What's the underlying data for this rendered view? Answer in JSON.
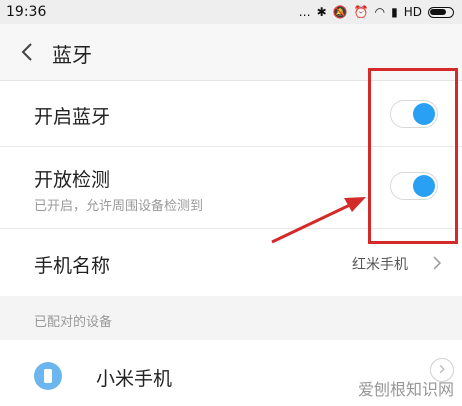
{
  "status_bar": {
    "time": "19:36",
    "network": "HD"
  },
  "header": {
    "title": "蓝牙"
  },
  "settings": {
    "bluetooth": {
      "label": "开启蓝牙",
      "on": true
    },
    "discoverable": {
      "label": "开放检测",
      "sub": "已开启，允许周围设备检测到",
      "on": true
    },
    "device_name": {
      "label": "手机名称",
      "value": "红米手机"
    }
  },
  "paired": {
    "section_title": "已配对的设备",
    "devices": [
      {
        "name": "小米手机"
      }
    ]
  },
  "colors": {
    "accent": "#2aa0f4",
    "annotation": "#d42a2a"
  },
  "watermark": "爱刨根知识网"
}
